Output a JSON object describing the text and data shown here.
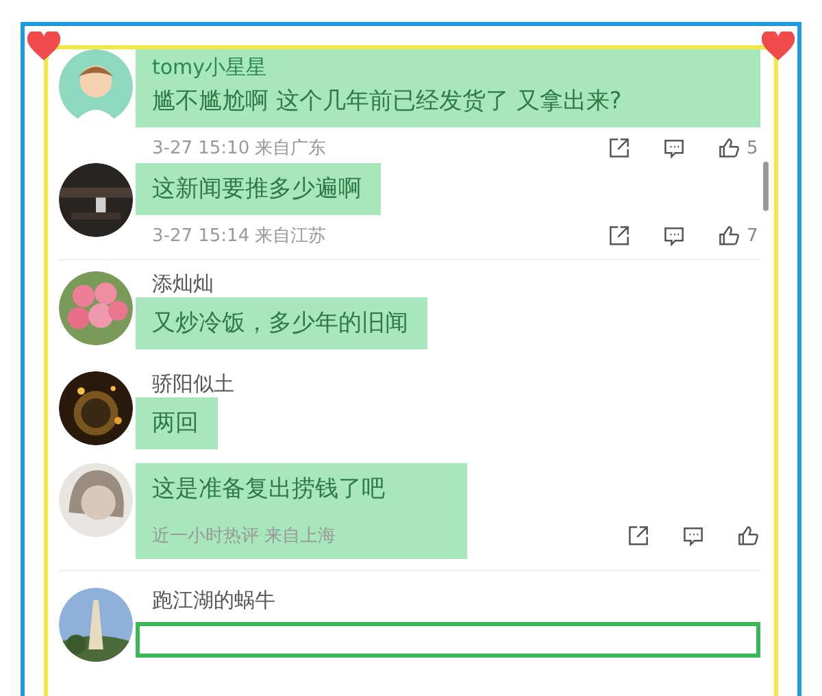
{
  "comments": [
    {
      "name": "tomy小星星",
      "text": "尴不尴尬啊  这个几年前已经发货了 又拿出来?",
      "meta": "3-27 15:10 来自广东",
      "likes": "5",
      "kind": "name-text"
    },
    {
      "text": "这新闻要推多少遍啊",
      "meta": "3-27 15:14 来自江苏",
      "likes": "7",
      "kind": "text"
    },
    {
      "name": "添灿灿",
      "text": "又炒冷饭，多少年的旧闻",
      "kind": "text"
    },
    {
      "name": "骄阳似土",
      "text": "两回",
      "kind": "text"
    },
    {
      "text": "这是准备复出捞钱了吧",
      "meta": "近一小时热评 来自上海",
      "kind": "text-meta"
    },
    {
      "name": "跑江湖的蜗牛",
      "kind": "outline"
    }
  ]
}
